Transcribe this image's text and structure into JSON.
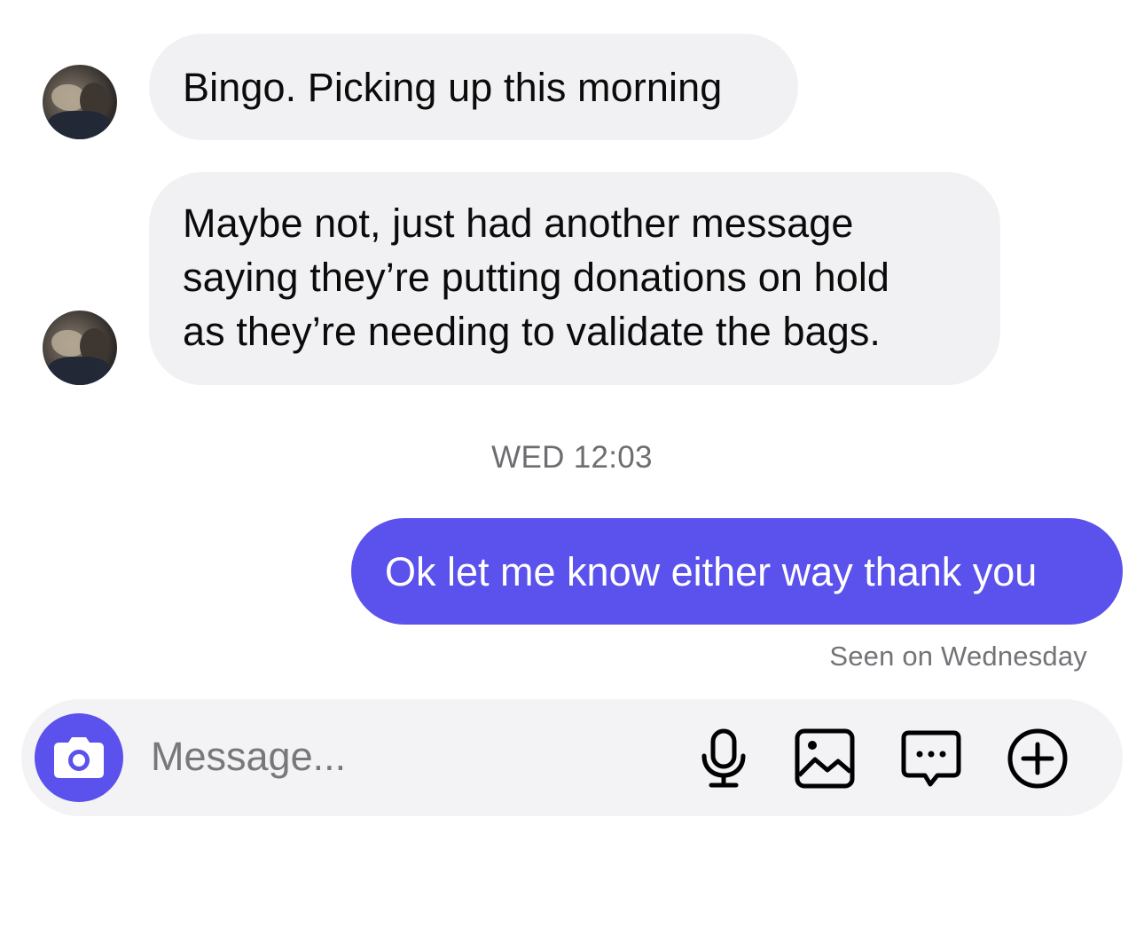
{
  "conversation": {
    "messages": [
      {
        "direction": "incoming",
        "text": "Bingo. Picking up this morning"
      },
      {
        "direction": "incoming",
        "lines": [
          "Maybe not, just had another message",
          "saying they’re putting donations on hold",
          "as they’re needing to validate the bags."
        ]
      },
      {
        "direction": "outgoing",
        "text": "Ok let me know either way thank you"
      }
    ],
    "timestamp": "WED 12:03",
    "read_receipt": "Seen on Wednesday"
  },
  "composer": {
    "placeholder": "Message...",
    "icons": [
      "camera-icon",
      "microphone-icon",
      "gallery-icon",
      "sticker-icon",
      "plus-icon"
    ]
  },
  "colors": {
    "accent": "#5b51ec",
    "incoming_bubble": "#f1f1f3",
    "composer_bg": "#f3f3f5"
  }
}
